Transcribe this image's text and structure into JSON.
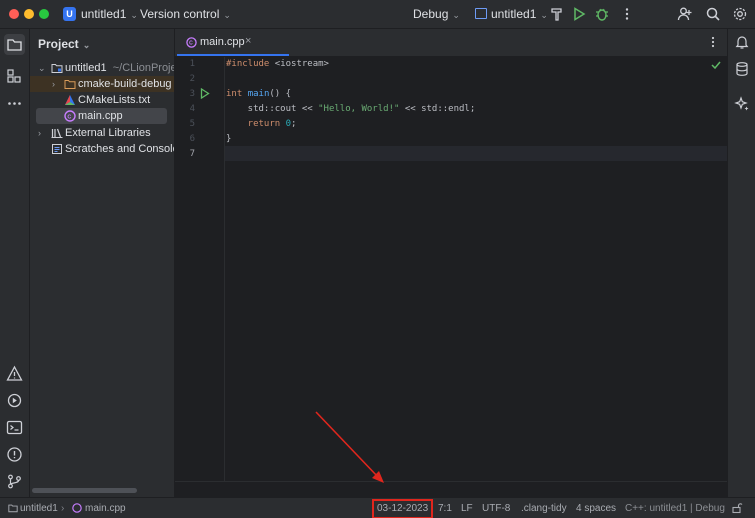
{
  "titlebar": {
    "project_badge": "U",
    "project_name": "untitled1",
    "version_control": "Version control",
    "build_config": "Debug",
    "run_target": "untitled1",
    "colors": {
      "close": "#fe5f57",
      "minimize": "#febc2e",
      "maximize": "#28c840",
      "accent": "#3574f0"
    }
  },
  "left_strip": {
    "icons": [
      "folder-icon",
      "structure-icon",
      "more-icon",
      "problems-icon",
      "services-icon",
      "terminal-icon",
      "warning-circle-icon",
      "git-icon"
    ]
  },
  "project_panel": {
    "title": "Project",
    "tree": [
      {
        "label": "untitled1",
        "path": "~/CLionProjects",
        "icon": "folder-icon",
        "expanded": true
      },
      {
        "label": "cmake-build-debug",
        "icon": "folder-icon",
        "expanded": false
      },
      {
        "label": "CMakeLists.txt",
        "icon": "cmake-icon"
      },
      {
        "label": "main.cpp",
        "icon": "cpp-file-icon",
        "selected": true
      },
      {
        "label": "External Libraries",
        "icon": "library-icon",
        "expanded": false
      },
      {
        "label": "Scratches and Consoles",
        "icon": "scratches-icon"
      }
    ]
  },
  "editor": {
    "tab_label": "main.cpp",
    "line_numbers": [
      "1",
      "2",
      "3",
      "4",
      "5",
      "6",
      "7"
    ],
    "lines": {
      "l1_directive": "#include",
      "l1_header": "<iostream>",
      "l3_kw": "int",
      "l3_fn": "main",
      "l3_rest": "() {",
      "l4_a": "    std::cout << ",
      "l4_str": "\"Hello, World!\"",
      "l4_b": " << std::endl;",
      "l5_kw": "    return",
      "l5_num": "0",
      "l5_end": ";",
      "l6": "}"
    }
  },
  "statusbar": {
    "breadcrumb_project": "untitled1",
    "breadcrumb_file": "main.cpp",
    "date": "03-12-2023",
    "caret": "7:1",
    "line_ending": "LF",
    "encoding": "UTF-8",
    "linter": ".clang-tidy",
    "indent": "4 spaces",
    "context_prefix": "C++: untitled1",
    "context_config": "Debug"
  }
}
